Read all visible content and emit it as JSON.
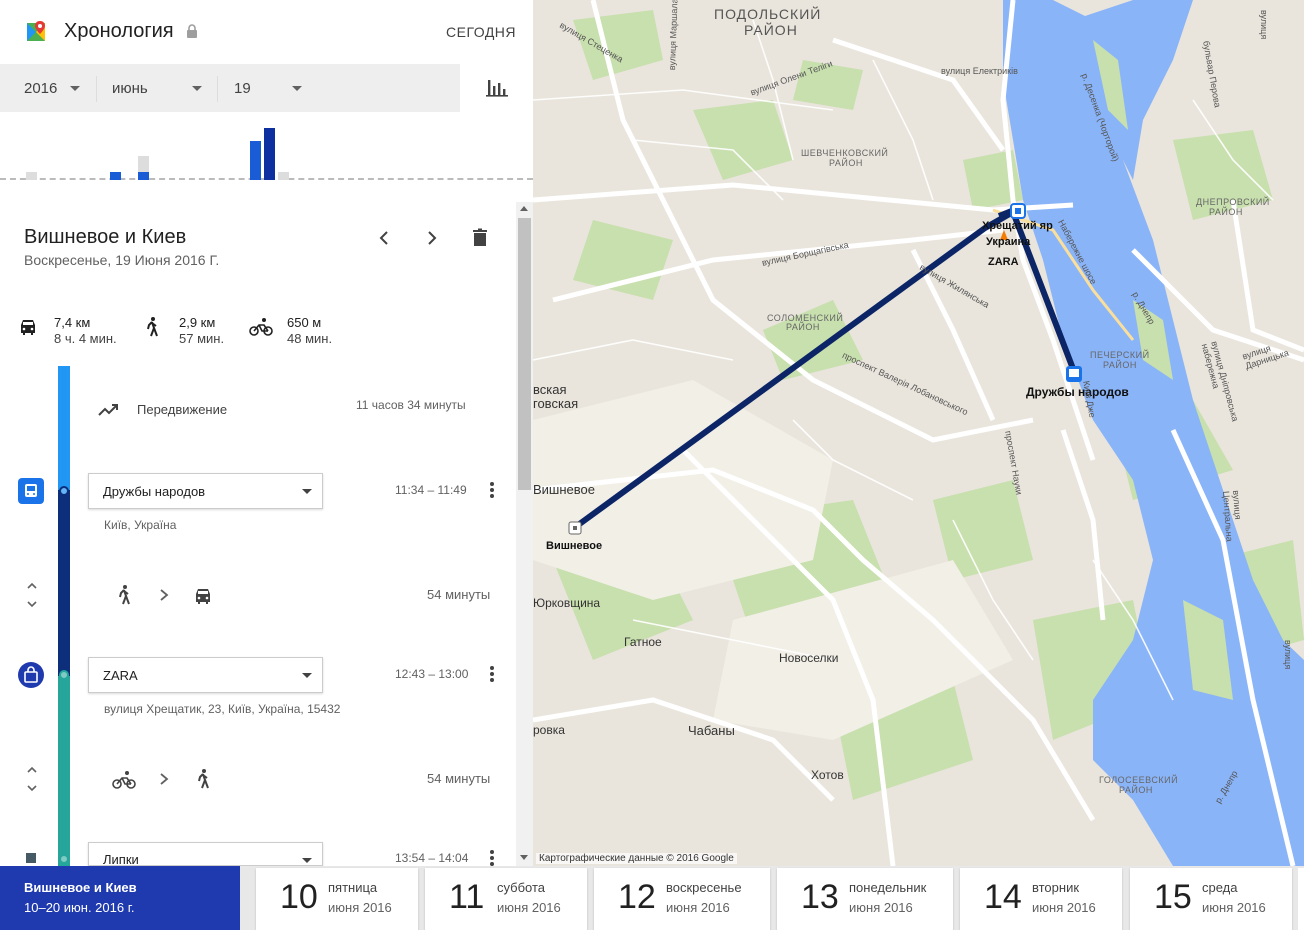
{
  "header": {
    "title": "Хронология",
    "today_label": "СЕГОДНЯ"
  },
  "date_selector": {
    "year": "2016",
    "month": "июнь",
    "day": "19"
  },
  "histogram": {
    "bars": [
      {
        "value": 0.15,
        "color": "#ddd"
      },
      {
        "value": 0.15,
        "color": "#1a5bd6"
      },
      {
        "value": 0.15,
        "color": "#1a5bd6"
      },
      {
        "value": 0.3,
        "color": "#ddd"
      },
      {
        "value": 0.75,
        "color": "#1a5bd6"
      },
      {
        "value": 1.0,
        "color": "#0d2fa0"
      },
      {
        "value": 0.15,
        "color": "#ddd"
      }
    ]
  },
  "day": {
    "title": "Вишневое и Киев",
    "subtitle": "Воскресенье, 19 Июня 2016 Г."
  },
  "summary": {
    "car": {
      "distance": "7,4 км",
      "duration": "8 ч. 4 мин."
    },
    "walk": {
      "distance": "2,9 км",
      "duration": "57 мин."
    },
    "bike": {
      "distance": "650 м",
      "duration": "48 мин."
    }
  },
  "timeline": {
    "movement": {
      "label": "Передвижение",
      "duration": "11 часов 34 минуты"
    },
    "places": [
      {
        "name": "Дружбы народов",
        "time": "11:34 – 11:49",
        "address": "Київ, Україна"
      },
      {
        "name": "ZARA",
        "time": "12:43 – 13:00",
        "address": "вулиця Хрещатик, 23, Київ, Україна, 15432"
      },
      {
        "name": "Липки",
        "time": "13:54 – 14:04",
        "address": ""
      }
    ],
    "segments": [
      {
        "duration": "54 минуты"
      },
      {
        "duration": "54 минуты"
      }
    ]
  },
  "map": {
    "labels": {
      "podolsky": "ПОДОЛЬСКИЙ",
      "rayon": "РАЙОН",
      "shevchenkovsky": "ШЕВЧЕНКОВСКИЙ",
      "solomensky": "СОЛОМЕНСКИЙ",
      "pechersky": "ПЕЧЕРСКИЙ",
      "dneprovsky": "ДНЕПРОВСКИЙ",
      "goloseevsky": "ГОЛОСЕЕВСКИЙ",
      "khreschaty": "Хрещатий яр",
      "ukraina": "Украина",
      "zara": "ZARA",
      "druzhby": "Дружбы народов",
      "vishnevoe_stop": "Вишневое",
      "vishnevoe_town": "Вишневое",
      "vskaya": "вская",
      "govskaya": "говская",
      "yurkovschina": "Юрковщина",
      "gatnoe": "Гатное",
      "novoselki": "Новоселки",
      "chabany": "Чабаны",
      "khotov": "Хотов",
      "rovka": "ровка",
      "vul_stetsenka": "вулиця Стеценка",
      "vul_marshala": "вулиця Маршала",
      "vul_oleny": "вулиця Олени Теліги",
      "vul_elektrykiv": "вулиця Електриків",
      "vul_borshch": "вулиця Борщагівська",
      "vul_zhylyan": "вулиця Жилянська",
      "prosp_lobanovsky": "проспект Валерія Лобановського",
      "nab_shose": "Набережне шосе",
      "r_dnepr": "р. Днепр",
      "r_desenka": "р. Десенка (Чорторой)",
      "bulvar_perova": "бульвар Перова",
      "darnytska": "вулиця Дарницька",
      "dniprovska_nab": "вулиця Дніпровська набережна",
      "prosp_nauky": "проспект Науки",
      "kyivdzhe": "Київ Дже",
      "tsentralna": "вулиця Центральна",
      "r_dnepr2": "р. Днепр",
      "vul_lisova": "вулиця",
      "vul_rig": "вулиця"
    },
    "attribution": "Картографические данные © 2016 Google"
  },
  "trip": {
    "name": "Вишневое и Киев",
    "dates": "10–20 июн. 2016 г."
  },
  "days": [
    {
      "num": "10",
      "weekday": "пятница",
      "month": "июня 2016"
    },
    {
      "num": "11",
      "weekday": "суббота",
      "month": "июня 2016"
    },
    {
      "num": "12",
      "weekday": "воскресенье",
      "month": "июня 2016"
    },
    {
      "num": "13",
      "weekday": "понедельник",
      "month": "июня 2016"
    },
    {
      "num": "14",
      "weekday": "вторник",
      "month": "июня 2016"
    },
    {
      "num": "15",
      "weekday": "среда",
      "month": "июня 2016"
    }
  ],
  "colors": {
    "accent": "#1f3aae",
    "route": "#0b2566",
    "timeline_blue": "#2196f3",
    "timeline_teal": "#26a69a"
  }
}
